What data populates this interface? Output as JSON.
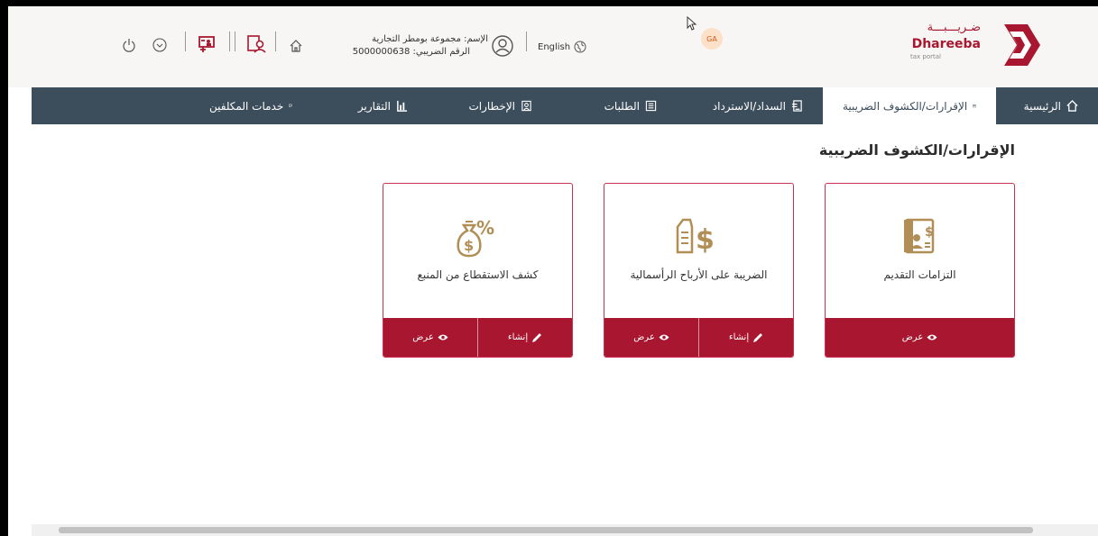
{
  "header": {
    "logo_ar": "ضـريـــبـــة",
    "logo_en": "Dhareeba",
    "logo_sub": "tax portal",
    "avatar_initials": "GA",
    "language": "English",
    "user_name_line": "الإسم: مجموعة بومطر التجارية",
    "tax_number_line": "الرقم الضريبي: 5000000638",
    "colors": {
      "brand": "#a8172f",
      "navbar": "#3c4d5c",
      "avatar_bg": "#fde0c8"
    }
  },
  "nav": {
    "items": [
      {
        "label": "الرئيسية",
        "icon": "home-icon"
      },
      {
        "label": "الإقرارات/الكشوف الضريبية",
        "icon": "calendar-icon"
      },
      {
        "label": "السداد/الاسترداد",
        "icon": "payment-icon"
      },
      {
        "label": "الطلبات",
        "icon": "list-icon"
      },
      {
        "label": "الإخطارات",
        "icon": "notification-icon"
      },
      {
        "label": "التقارير",
        "icon": "bar-chart-icon"
      },
      {
        "label": "خدمات المكلفين",
        "icon": "presentation-icon"
      }
    ],
    "active": "الإقرارات/الكشوف الضريبية"
  },
  "page": {
    "title": "الإقرارات/الكشوف الضريبية"
  },
  "cards": [
    {
      "label": "التزامات التقديم",
      "icon": "filing-document-icon",
      "view_label": "عرض"
    },
    {
      "label": "الضريبة على الأرباح الرأسمالية",
      "icon": "capital-gains-icon",
      "create_label": "إنشاء",
      "view_label": "عرض"
    },
    {
      "label": "كشف الاستقطاع من المنبع",
      "icon": "withholding-money-bag-icon",
      "create_label": "إنشاء",
      "view_label": "عرض"
    }
  ]
}
